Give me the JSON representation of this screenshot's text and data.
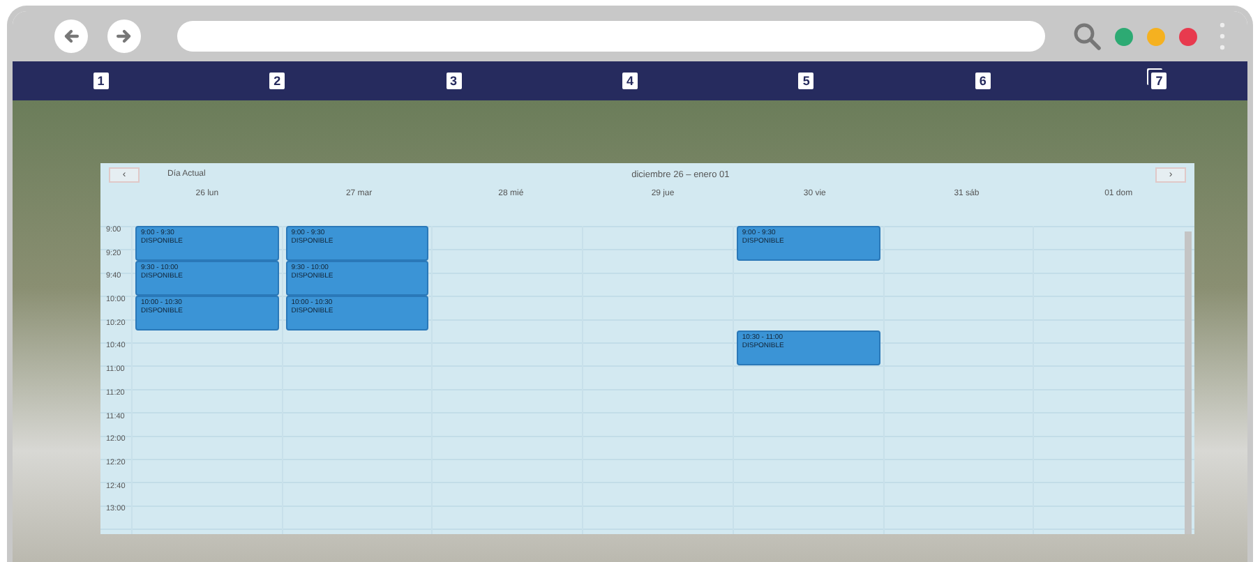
{
  "nav_bar": {
    "items": [
      {
        "label": "1",
        "kind": "plain"
      },
      {
        "label": "2",
        "kind": "plain"
      },
      {
        "label": "3",
        "kind": "plain"
      },
      {
        "label": "4",
        "kind": "plain"
      },
      {
        "label": "5",
        "kind": "plain"
      },
      {
        "label": "6",
        "kind": "plain"
      },
      {
        "label": "7",
        "kind": "stacked"
      }
    ]
  },
  "calendar": {
    "prev_button": "‹",
    "today_button": "Día Actual",
    "title": "diciembre 26 – enero 01",
    "next_button": "›",
    "times": [
      "9:00",
      "9:20",
      "9:40",
      "10:00",
      "10:20",
      "10:40",
      "11:00",
      "11:20",
      "11:40",
      "12:00",
      "12:20",
      "12:40",
      "13:00"
    ],
    "days": [
      {
        "label": "26 lun",
        "slots": [
          {
            "kind": "event",
            "time": "9:00 - 9:30",
            "title": "DISPONIBLE"
          },
          {
            "kind": "event",
            "time": "9:30 - 10:00",
            "title": "DISPONIBLE"
          },
          {
            "kind": "event",
            "time": "10:00 - 10:30",
            "title": "DISPONIBLE"
          }
        ]
      },
      {
        "label": "27 mar",
        "slots": [
          {
            "kind": "event",
            "time": "9:00 - 9:30",
            "title": "DISPONIBLE"
          },
          {
            "kind": "event",
            "time": "9:30 - 10:00",
            "title": "DISPONIBLE"
          },
          {
            "kind": "event",
            "time": "10:00 - 10:30",
            "title": "DISPONIBLE"
          }
        ]
      },
      {
        "label": "28 mié"
      },
      {
        "label": "29 jue"
      },
      {
        "label": "30 vie",
        "slots": [
          {
            "kind": "event",
            "time": "9:00 - 9:30",
            "title": "DISPONIBLE"
          },
          {
            "kind": "empty"
          },
          {
            "kind": "empty"
          },
          {
            "kind": "event",
            "time": "10:30 - 11:00",
            "title": "DISPONIBLE"
          }
        ]
      },
      {
        "label": "31 sáb"
      },
      {
        "label": "01 dom"
      }
    ]
  }
}
